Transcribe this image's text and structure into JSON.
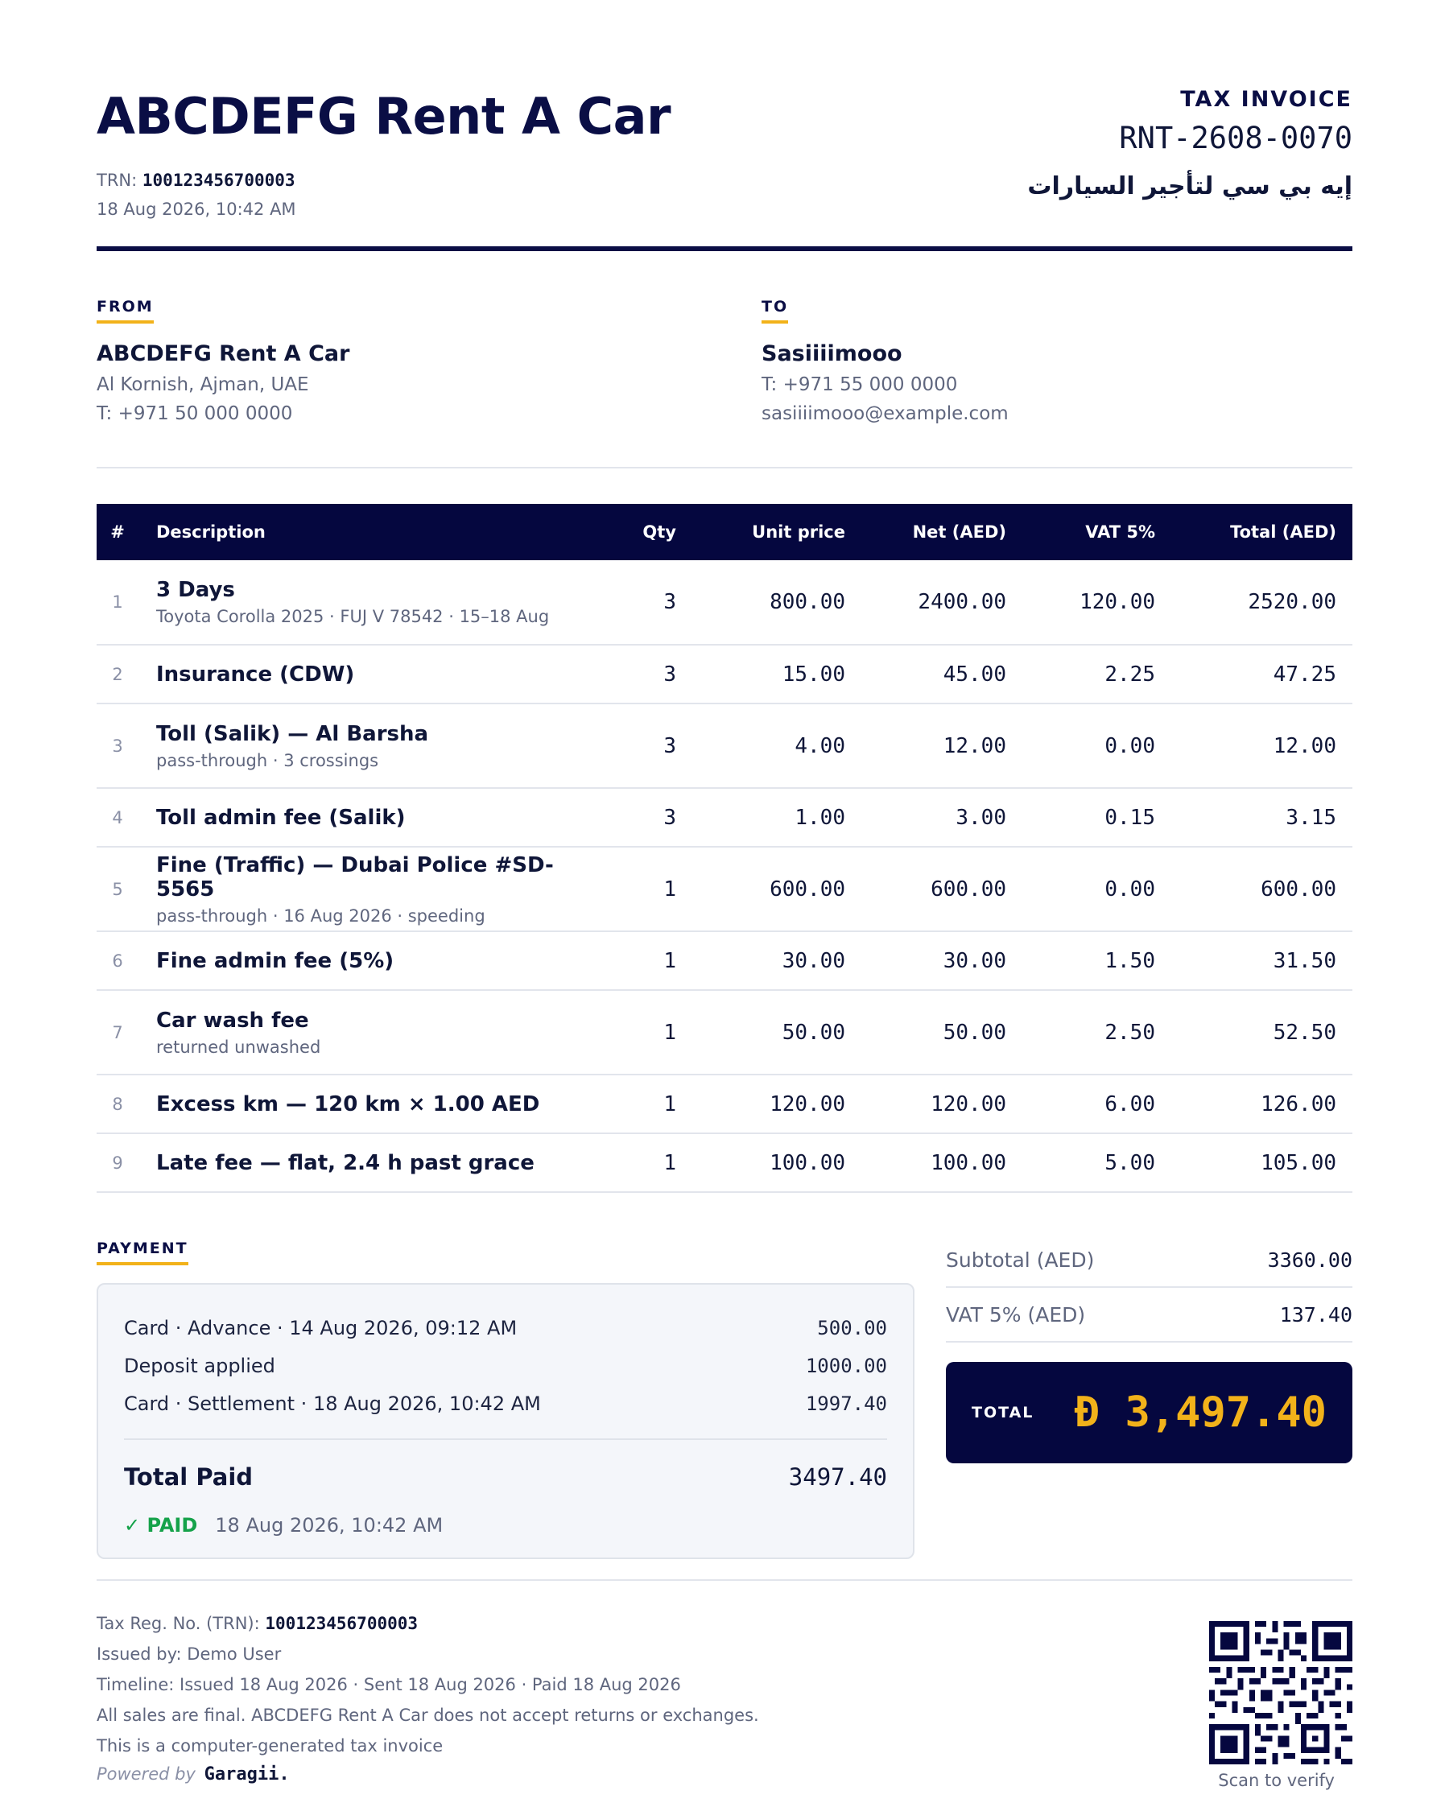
{
  "header": {
    "brand": "ABCDEFG Rent A Car",
    "trn_label": "TRN:",
    "trn_value": "100123456700003",
    "issued": "18 Aug 2026, 10:42 AM",
    "doc_type": "TAX INVOICE",
    "doc_number": "RNT-2608-0070",
    "arabic_name": "إيه بي سي لتأجير السيارات"
  },
  "from": {
    "label": "FROM",
    "name": "ABCDEFG Rent A Car",
    "address": "Al Kornish, Ajman, UAE",
    "phone": "T: +971 50 000 0000"
  },
  "to": {
    "label": "TO",
    "name": "Sasiiiimooo",
    "phone": "T: +971 55 000 0000",
    "email": "sasiiiimooo@example.com"
  },
  "table": {
    "headers": [
      "#",
      "Description",
      "Qty",
      "Unit price",
      "Net (AED)",
      "VAT 5%",
      "Total (AED)"
    ],
    "rows": [
      {
        "idx": "1",
        "title": "3 Days",
        "sub": "Toyota Corolla 2025 · FUJ V 78542 · 15–18 Aug",
        "qty": "3",
        "unit": "800.00",
        "net": "2400.00",
        "vat": "120.00",
        "total": "2520.00"
      },
      {
        "idx": "2",
        "title": "Insurance (CDW)",
        "sub": "",
        "qty": "3",
        "unit": "15.00",
        "net": "45.00",
        "vat": "2.25",
        "total": "47.25"
      },
      {
        "idx": "3",
        "title": "Toll (Salik) — Al Barsha",
        "sub": "pass-through · 3 crossings",
        "qty": "3",
        "unit": "4.00",
        "net": "12.00",
        "vat": "0.00",
        "total": "12.00"
      },
      {
        "idx": "4",
        "title": "Toll admin fee (Salik)",
        "sub": "",
        "qty": "3",
        "unit": "1.00",
        "net": "3.00",
        "vat": "0.15",
        "total": "3.15"
      },
      {
        "idx": "5",
        "title": "Fine (Traffic) — Dubai Police #SD-5565",
        "sub": "pass-through · 16 Aug 2026 · speeding",
        "qty": "1",
        "unit": "600.00",
        "net": "600.00",
        "vat": "0.00",
        "total": "600.00"
      },
      {
        "idx": "6",
        "title": "Fine admin fee (5%)",
        "sub": "",
        "qty": "1",
        "unit": "30.00",
        "net": "30.00",
        "vat": "1.50",
        "total": "31.50"
      },
      {
        "idx": "7",
        "title": "Car wash fee",
        "sub": "returned unwashed",
        "qty": "1",
        "unit": "50.00",
        "net": "50.00",
        "vat": "2.50",
        "total": "52.50"
      },
      {
        "idx": "8",
        "title": "Excess km — 120 km × 1.00 AED",
        "sub": "",
        "qty": "1",
        "unit": "120.00",
        "net": "120.00",
        "vat": "6.00",
        "total": "126.00"
      },
      {
        "idx": "9",
        "title": "Late fee — flat, 2.4 h past grace",
        "sub": "",
        "qty": "1",
        "unit": "100.00",
        "net": "100.00",
        "vat": "5.00",
        "total": "105.00"
      }
    ]
  },
  "payment": {
    "label": "PAYMENT",
    "lines": [
      {
        "label": "Card · Advance · 14 Aug 2026, 09:12 AM",
        "amount": "500.00"
      },
      {
        "label": "Deposit applied",
        "amount": "1000.00"
      },
      {
        "label": "Card · Settlement · 18 Aug 2026, 10:42 AM",
        "amount": "1997.40"
      }
    ],
    "total_label": "Total Paid",
    "total_value": "3497.40",
    "status": "✓ PAID",
    "status_date": "18 Aug 2026, 10:42 AM",
    "status_color": "#15a24a"
  },
  "summary": {
    "subtotal_label": "Subtotal (AED)",
    "subtotal_value": "3360.00",
    "vat_label": "VAT 5% (AED)",
    "vat_value": "137.40",
    "total_label": "TOTAL",
    "total_value": "Đ 3,497.40"
  },
  "footer": {
    "trn_label": "Tax Reg. No. (TRN):",
    "trn_value": "100123456700003",
    "issued_by": "Issued by: Demo User",
    "timeline": "Timeline: Issued 18 Aug 2026 · Sent 18 Aug 2026 · Paid 18 Aug 2026",
    "policy": "All sales are final. ABCDEFG Rent A Car does not accept returns or exchanges.",
    "note": "This is a computer-generated tax invoice",
    "powered_by": "Powered by",
    "powered_brand": "Garagii.",
    "scan_label": "Scan to verify"
  },
  "colors": {
    "navy": "#05073f",
    "accent": "#f2b21a",
    "paid_green": "#15a24a"
  }
}
